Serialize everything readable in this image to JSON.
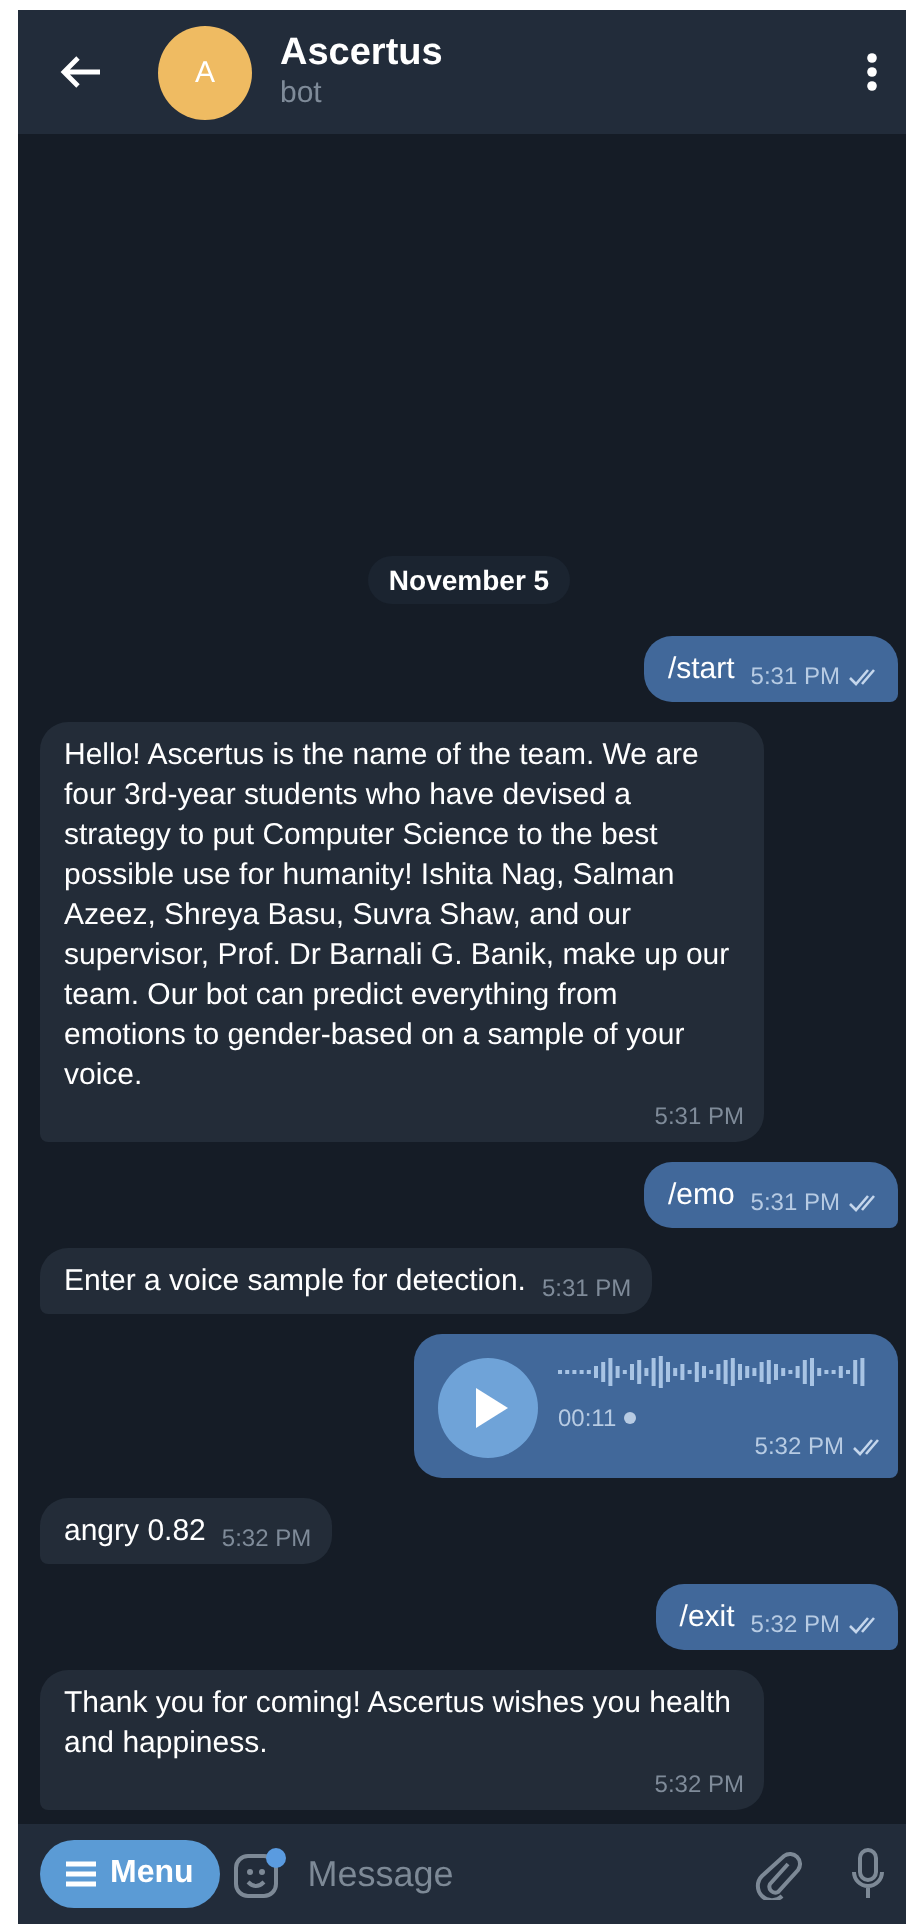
{
  "header": {
    "avatar_letter": "A",
    "title": "Ascertus",
    "subtitle": "bot"
  },
  "date": "November 5",
  "messages": [
    {
      "kind": "text",
      "outgoing": true,
      "text": "/start",
      "time": "5:31 PM",
      "read": true
    },
    {
      "kind": "text",
      "outgoing": false,
      "text": "Hello! Ascertus is the name of the team. We are four 3rd-year students who have devised a strategy to put Computer Science to the best possible use for humanity! Ishita Nag, Salman Azeez, Shreya Basu, Suvra Shaw, and our supervisor, Prof. Dr Barnali G. Banik, make up our team. Our bot can predict everything from emotions to gender-based on a sample of your voice.",
      "time": "5:31 PM"
    },
    {
      "kind": "text",
      "outgoing": true,
      "text": "/emo",
      "time": "5:31 PM",
      "read": true
    },
    {
      "kind": "text",
      "outgoing": false,
      "text": "Enter a voice sample for detection.",
      "time": "5:31 PM"
    },
    {
      "kind": "voice",
      "outgoing": true,
      "duration": "00:11",
      "time": "5:32 PM",
      "read": true
    },
    {
      "kind": "text",
      "outgoing": false,
      "text": "angry 0.82",
      "time": "5:32 PM"
    },
    {
      "kind": "text",
      "outgoing": true,
      "text": "/exit",
      "time": "5:32 PM",
      "read": true
    },
    {
      "kind": "text",
      "outgoing": false,
      "text": "Thank you for coming! Ascertus wishes you health and happiness.",
      "time": "5:32 PM"
    }
  ],
  "input": {
    "menu_label": "Menu",
    "placeholder": "Message"
  }
}
